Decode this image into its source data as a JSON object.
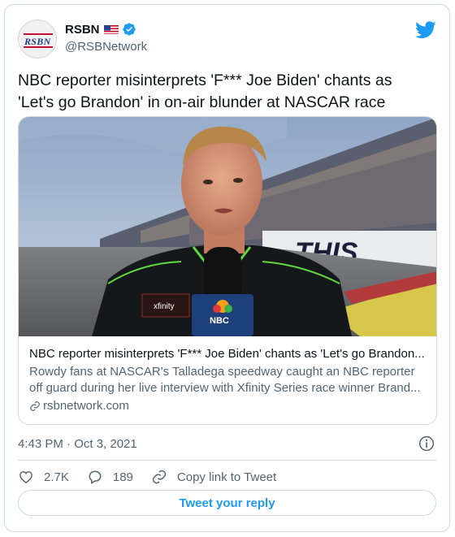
{
  "author": {
    "display_name": "RSBN",
    "handle": "@RSBNetwork",
    "avatar_text": "RSBN",
    "verified": true,
    "flag": "us-flag-icon"
  },
  "brand": {
    "icon": "twitter-bird-icon",
    "color": "#1d9bf0"
  },
  "tweet": {
    "text": "NBC reporter misinterprets 'F*** Joe Biden' chants as 'Let's go Brandon' in on-air blunder at NASCAR race"
  },
  "link_card": {
    "image_sign_text": "THIS",
    "title": "NBC reporter misinterprets 'F*** Joe Biden' chants as 'Let's go Brandon...",
    "description": "Rowdy fans at NASCAR's Talladega speedway caught an NBC reporter off guard during her live interview with Xfinity Series race winner Brand...",
    "domain": "rsbnetwork.com"
  },
  "meta": {
    "timestamp": "4:43 PM · Oct 3, 2021"
  },
  "actions": {
    "likes": "2.7K",
    "replies": "189",
    "copy_link_label": "Copy link to Tweet"
  },
  "reply_button": {
    "label": "Tweet your reply"
  },
  "colors": {
    "accent": "#1d9bf0",
    "text_primary": "#0f1419",
    "text_secondary": "#536471",
    "border": "#cfd9de",
    "verified": "#1d9bf0"
  }
}
